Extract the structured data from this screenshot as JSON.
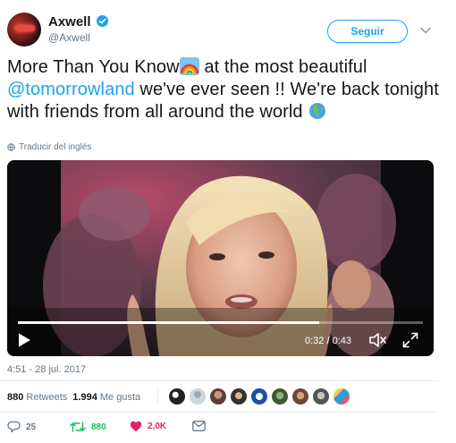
{
  "author": {
    "name": "Axwell",
    "handle": "@Axwell",
    "verified": true
  },
  "follow_label": "Seguir",
  "tweet": {
    "part1": "More Than You Know",
    "part2": " at the most beautiful ",
    "mention": "@tomorrowland",
    "part3": " we've ever seen !! We're back tonight with friends from all around the world ",
    "emoji1": "rainbow",
    "emoji2": "globe-africa"
  },
  "translate_label": "Traducir del inglés",
  "video": {
    "time": "0:32 / 0:43",
    "progress": 0.744
  },
  "timestamp": "4:51 - 28 jul. 2017",
  "stats": {
    "retweets_count": "880",
    "retweets_label": "Retweets",
    "likes_count": "1.994",
    "likes_label": "Me gusta"
  },
  "actions": {
    "reply_count": "25",
    "retweet_count": "880",
    "like_count": "2,0K"
  },
  "colors": {
    "accent": "#1da1f2",
    "retweet": "#17bf63",
    "like": "#e0245e",
    "muted": "#657786"
  }
}
